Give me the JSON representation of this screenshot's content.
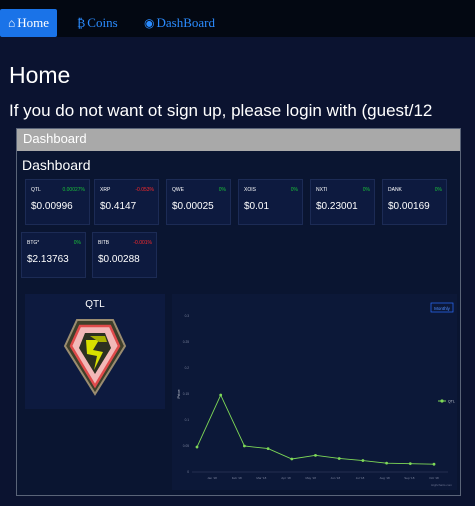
{
  "nav": {
    "home": "Home",
    "coins": "Coins",
    "dashboard": "DashBoard"
  },
  "page": {
    "title": "Home",
    "login_message": "If you do not want ot sign up, please login with (guest/12"
  },
  "panel": {
    "heading": "Dashboard",
    "subheading": "Dashboard"
  },
  "coins": [
    {
      "name": "QTL",
      "change": "0.00027%",
      "price": "$0.00996",
      "trend": "up"
    },
    {
      "name": "XRP",
      "change": "-0.053%",
      "price": "$0.4147",
      "trend": "down"
    },
    {
      "name": "QWE",
      "change": "0%",
      "price": "$0.00025",
      "trend": "up"
    },
    {
      "name": "XOIS",
      "change": "0%",
      "price": "$0.01",
      "trend": "up"
    },
    {
      "name": "NXTI",
      "change": "0%",
      "price": "$0.23001",
      "trend": "up"
    },
    {
      "name": "DANK",
      "change": "0%",
      "price": "$0.00169",
      "trend": "up"
    },
    {
      "name": "BTG*",
      "change": "0%",
      "price": "$2.13763",
      "trend": "up"
    },
    {
      "name": "BITB",
      "change": "-0.001%",
      "price": "$0.00288",
      "trend": "down"
    }
  ],
  "qtl_card": {
    "title": "QTL",
    "logo_icon": "qtl-shield-icon"
  },
  "chart_data": {
    "type": "line",
    "button": "Monthly",
    "x": [
      "Jan '18",
      "Feb '18",
      "Mar '18",
      "Apr '18",
      "May '18",
      "Jun '18",
      "Jul '18",
      "Aug '18",
      "Sep '18",
      "Oct '18"
    ],
    "yticks": [
      "0",
      "0.05",
      "0.1",
      "0.15",
      "0.2",
      "0.25",
      "0.3"
    ],
    "ylim": [
      0,
      0.3
    ],
    "ylabel": "Price",
    "series": [
      {
        "name": "QTL",
        "color": "#7ed957",
        "values": [
          0.048,
          0.148,
          0.05,
          0.045,
          0.025,
          0.032,
          0.026,
          0.022,
          0.017,
          0.016,
          0.015
        ]
      }
    ],
    "credit": "Highcharts.com"
  },
  "colors": {
    "nav_active": "#1a73e8",
    "link": "#2b8cff",
    "up": "#19c23a",
    "down": "#ff2a2a",
    "line": "#7ed957"
  }
}
